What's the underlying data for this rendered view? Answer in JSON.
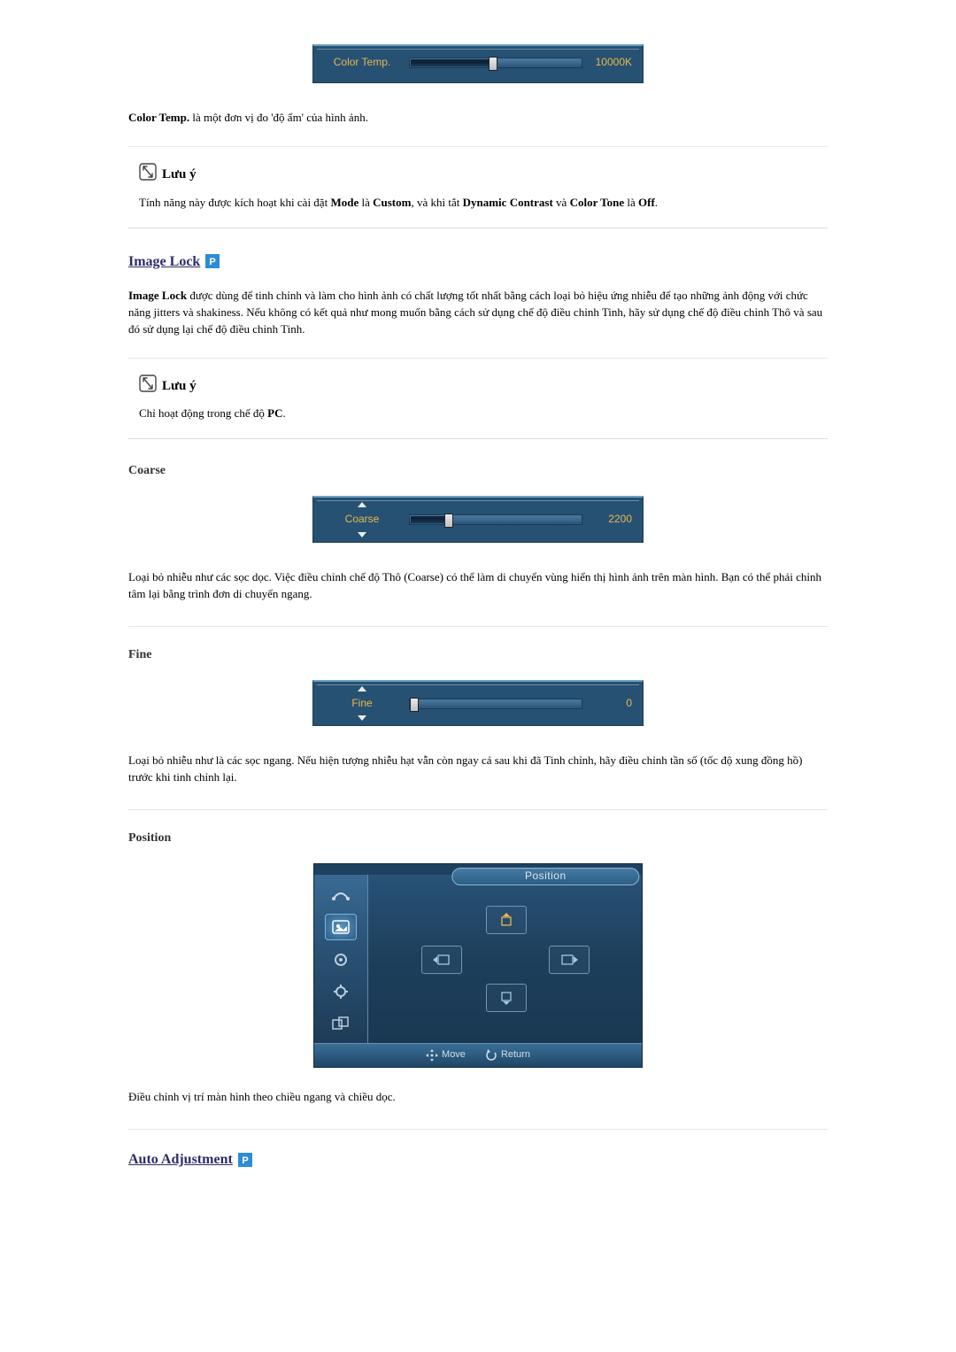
{
  "color_temp": {
    "label": "Color Temp.",
    "value": "10000K",
    "fill_pct": 46,
    "desc_prefix": "Color Temp.",
    "desc_rest": " là một đơn vị đo 'độ ẩm' của hình ảnh."
  },
  "note1": {
    "title": " Lưu ý",
    "body_parts": [
      "Tính năng này được kích hoạt khi cài đặt ",
      "Mode",
      " là ",
      "Custom",
      ", và khi tắt ",
      "Dynamic Contrast",
      " và ",
      "Color Tone",
      " là ",
      "Off",
      "."
    ]
  },
  "image_lock": {
    "title": "Image Lock",
    "desc_prefix": "Image Lock",
    "desc_rest": " được dùng để tinh chỉnh và làm cho hình ảnh có chất lượng tốt nhất bằng cách loại bỏ hiệu ứng nhiễu để tạo những ảnh động với chức năng jitters và shakiness. Nếu không có kết quả như mong muốn bằng cách sử dụng chế độ điều chỉnh Tinh, hãy sử dụng chế độ điều chỉnh Thô và sau đó sử dụng lại chế độ điều chỉnh Tinh."
  },
  "note2": {
    "title": " Lưu ý",
    "body_parts": [
      "Chỉ hoạt động trong chế độ ",
      "PC",
      "."
    ]
  },
  "coarse": {
    "title": "Coarse",
    "label": "Coarse",
    "value": "2200",
    "fill_pct": 20,
    "desc": "Loại bỏ nhiễu như các sọc dọc. Việc điều chỉnh chế độ Thô (Coarse) có thể làm di chuyển vùng hiển thị hình ảnh trên màn hình. Bạn có thể phải chỉnh tâm lại bằng trình đơn di chuyển ngang."
  },
  "fine": {
    "title": "Fine",
    "label": "Fine",
    "value": "0",
    "fill_pct": 0,
    "desc": "Loại bỏ nhiễu như là các sọc ngang. Nếu hiện tượng nhiễu hạt vẫn còn ngay cả sau khi đã Tinh chỉnh, hãy điều chỉnh tần số (tốc độ xung đồng hồ) trước khi tinh chỉnh lại."
  },
  "position": {
    "title": "Position",
    "header": "Position",
    "hint_move": "Move",
    "hint_return": "Return",
    "desc": "Điều chỉnh vị trí màn hình theo chiều ngang và chiều dọc."
  },
  "auto_adjust": {
    "title": "Auto Adjustment"
  }
}
